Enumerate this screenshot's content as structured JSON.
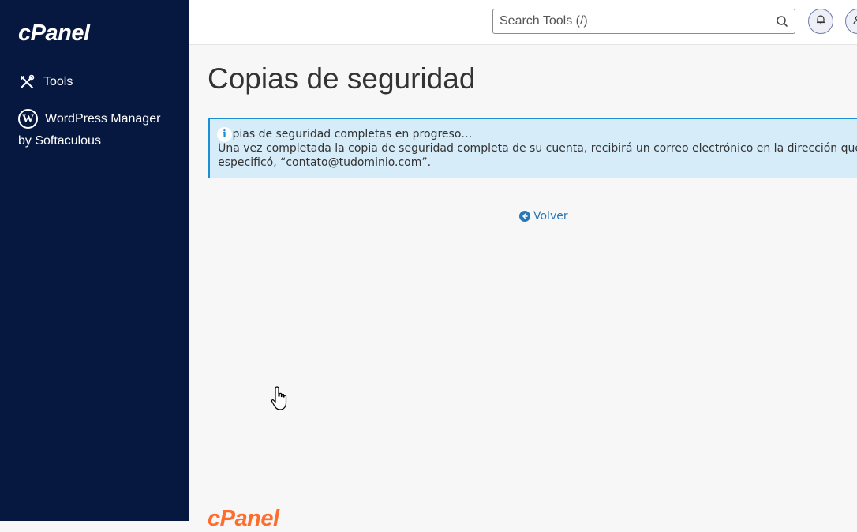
{
  "sidebar": {
    "logo": "cPanel",
    "items": [
      {
        "label": "Tools",
        "icon": "tools-icon"
      },
      {
        "label_line1": "WordPress Manager",
        "label_line2": "by Softaculous",
        "icon": "wordpress-icon"
      }
    ]
  },
  "topbar": {
    "search_placeholder": "Search Tools (/)"
  },
  "main": {
    "title": "Copias de seguridad",
    "alert": {
      "line1": "Copias de seguridad completas en progreso…",
      "line2": "Una vez completada la copia de seguridad completa de su cuenta, recibirá un correo electrónico en la dirección que",
      "line3": "especificó, “contato@tudominio.com”."
    },
    "back_label": "Volver"
  },
  "footer": {
    "logo": "cPanel"
  },
  "colors": {
    "sidebar_bg": "#071840",
    "alert_accent": "#1a8fd6",
    "link": "#2a77b8",
    "brand_orange": "#ff6c2c"
  }
}
